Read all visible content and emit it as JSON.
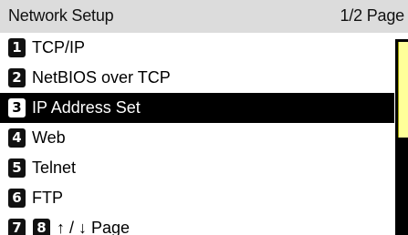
{
  "header": {
    "title": "Network Setup",
    "page_indicator": "1/2 Page"
  },
  "menu": {
    "items": [
      {
        "number": "1",
        "label": "TCP/IP"
      },
      {
        "number": "2",
        "label": "NetBIOS over TCP"
      },
      {
        "number": "3",
        "label": "IP Address Set",
        "selected": true
      },
      {
        "number": "4",
        "label": "Web"
      },
      {
        "number": "5",
        "label": "Telnet"
      },
      {
        "number": "6",
        "label": "FTP"
      }
    ],
    "paging": {
      "prev_number": "7",
      "next_number": "8",
      "label": "↑ / ↓ Page"
    }
  },
  "scrollbar": {
    "visible_fraction": 0.5,
    "track_color": "#000000",
    "thumb_color": "#ffff99"
  },
  "colors": {
    "header_bg": "#dcdcdc",
    "selected_bg": "#000000",
    "selected_text": "#ffffff"
  }
}
